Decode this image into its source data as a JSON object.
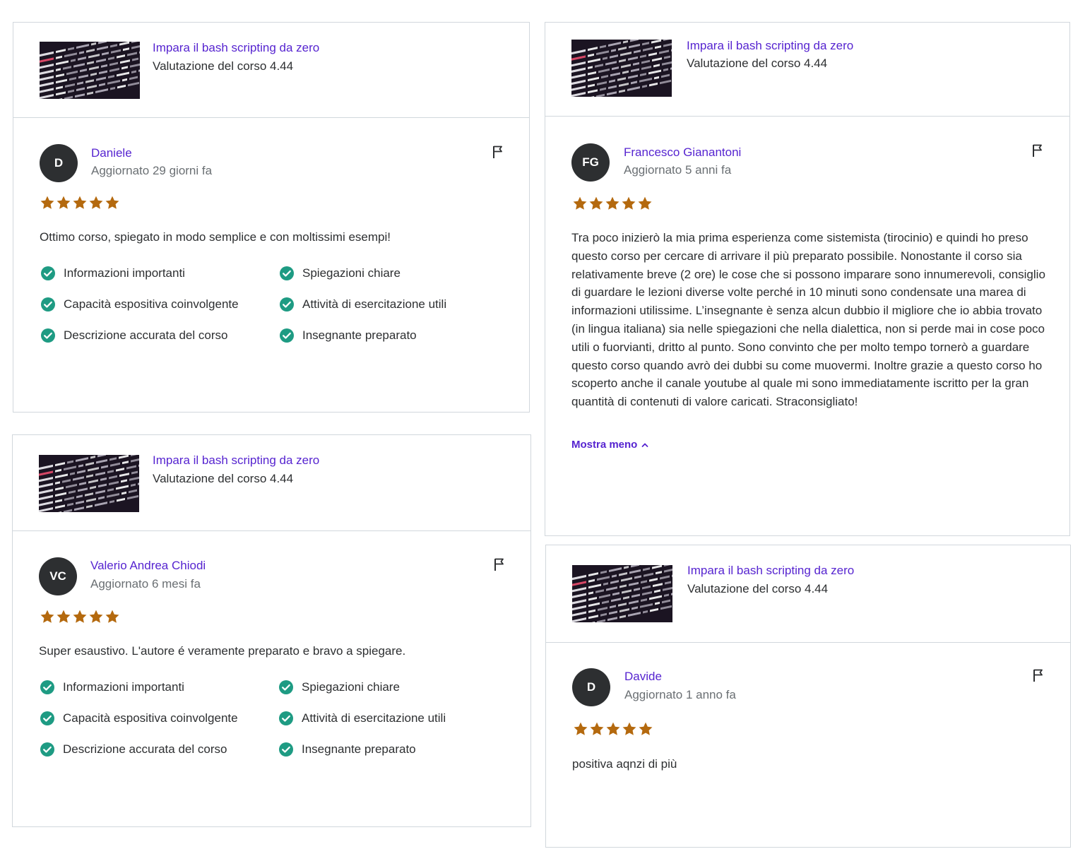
{
  "reviews": [
    {
      "course_title": "Impara il bash scripting da zero",
      "course_rating": "Valutazione del corso 4.44",
      "initials": "D",
      "name": "Daniele",
      "updated": "Aggiornato 29 giorni fa",
      "stars": 5,
      "text": "Ottimo corso, spiegato in modo semplice e con moltissimi esempi!",
      "tags": [
        "Informazioni importanti",
        "Spiegazioni chiare",
        "Capacità espositiva coinvolgente",
        "Attività di esercitazione utili",
        "Descrizione accurata del corso",
        "Insegnante preparato"
      ]
    },
    {
      "course_title": "Impara il bash scripting da zero",
      "course_rating": "Valutazione del corso 4.44",
      "initials": "VC",
      "name": "Valerio Andrea Chiodi",
      "updated": "Aggiornato 6 mesi fa",
      "stars": 5,
      "text": "Super esaustivo. L'autore é veramente preparato e bravo a spiegare.",
      "tags": [
        "Informazioni importanti",
        "Spiegazioni chiare",
        "Capacità espositiva coinvolgente",
        "Attività di esercitazione utili",
        "Descrizione accurata del corso",
        "Insegnante preparato"
      ]
    },
    {
      "course_title": "Impara il bash scripting da zero",
      "course_rating": "Valutazione del corso 4.44",
      "initials": "FG",
      "name": "Francesco Gianantoni",
      "updated": "Aggiornato 5 anni fa",
      "stars": 5,
      "text": "Tra poco inizierò la mia prima esperienza come sistemista (tirocinio) e quindi ho preso questo corso per cercare di arrivare il più preparato possibile. Nonostante il corso sia relativamente breve (2 ore) le cose che si possono imparare sono innumerevoli, consiglio di guardare le lezioni diverse volte perché in 10 minuti sono condensate una marea di informazioni utilissime. L’insegnante è senza alcun dubbio il migliore che io abbia trovato (in lingua italiana) sia nelle spiegazioni che nella dialettica, non si perde mai in cose poco utili o fuorvianti, dritto al punto. Sono convinto che per molto tempo tornerò a guardare questo corso quando avrò dei dubbi su come muovermi. Inoltre grazie a questo corso ho scoperto anche il canale youtube al quale mi sono immediatamente iscritto per la gran quantità di contenuti di valore caricati. Straconsigliato!",
      "more_label": "Mostra meno"
    },
    {
      "course_title": "Impara il bash scripting da zero",
      "course_rating": "Valutazione del corso 4.44",
      "initials": "D",
      "name": "Davide",
      "updated": "Aggiornato 1 anno fa",
      "stars": 5,
      "text": "positiva aqnzi di più"
    }
  ],
  "icons": {
    "flag": "flag-icon",
    "star": "star-icon",
    "check": "check-circle-icon",
    "chevron": "chevron-up-icon"
  },
  "colors": {
    "link": "#5624d0",
    "star": "#b4690e",
    "check": "#1e9b83",
    "avatar": "#2d2f31",
    "border": "#d1d7dc"
  }
}
